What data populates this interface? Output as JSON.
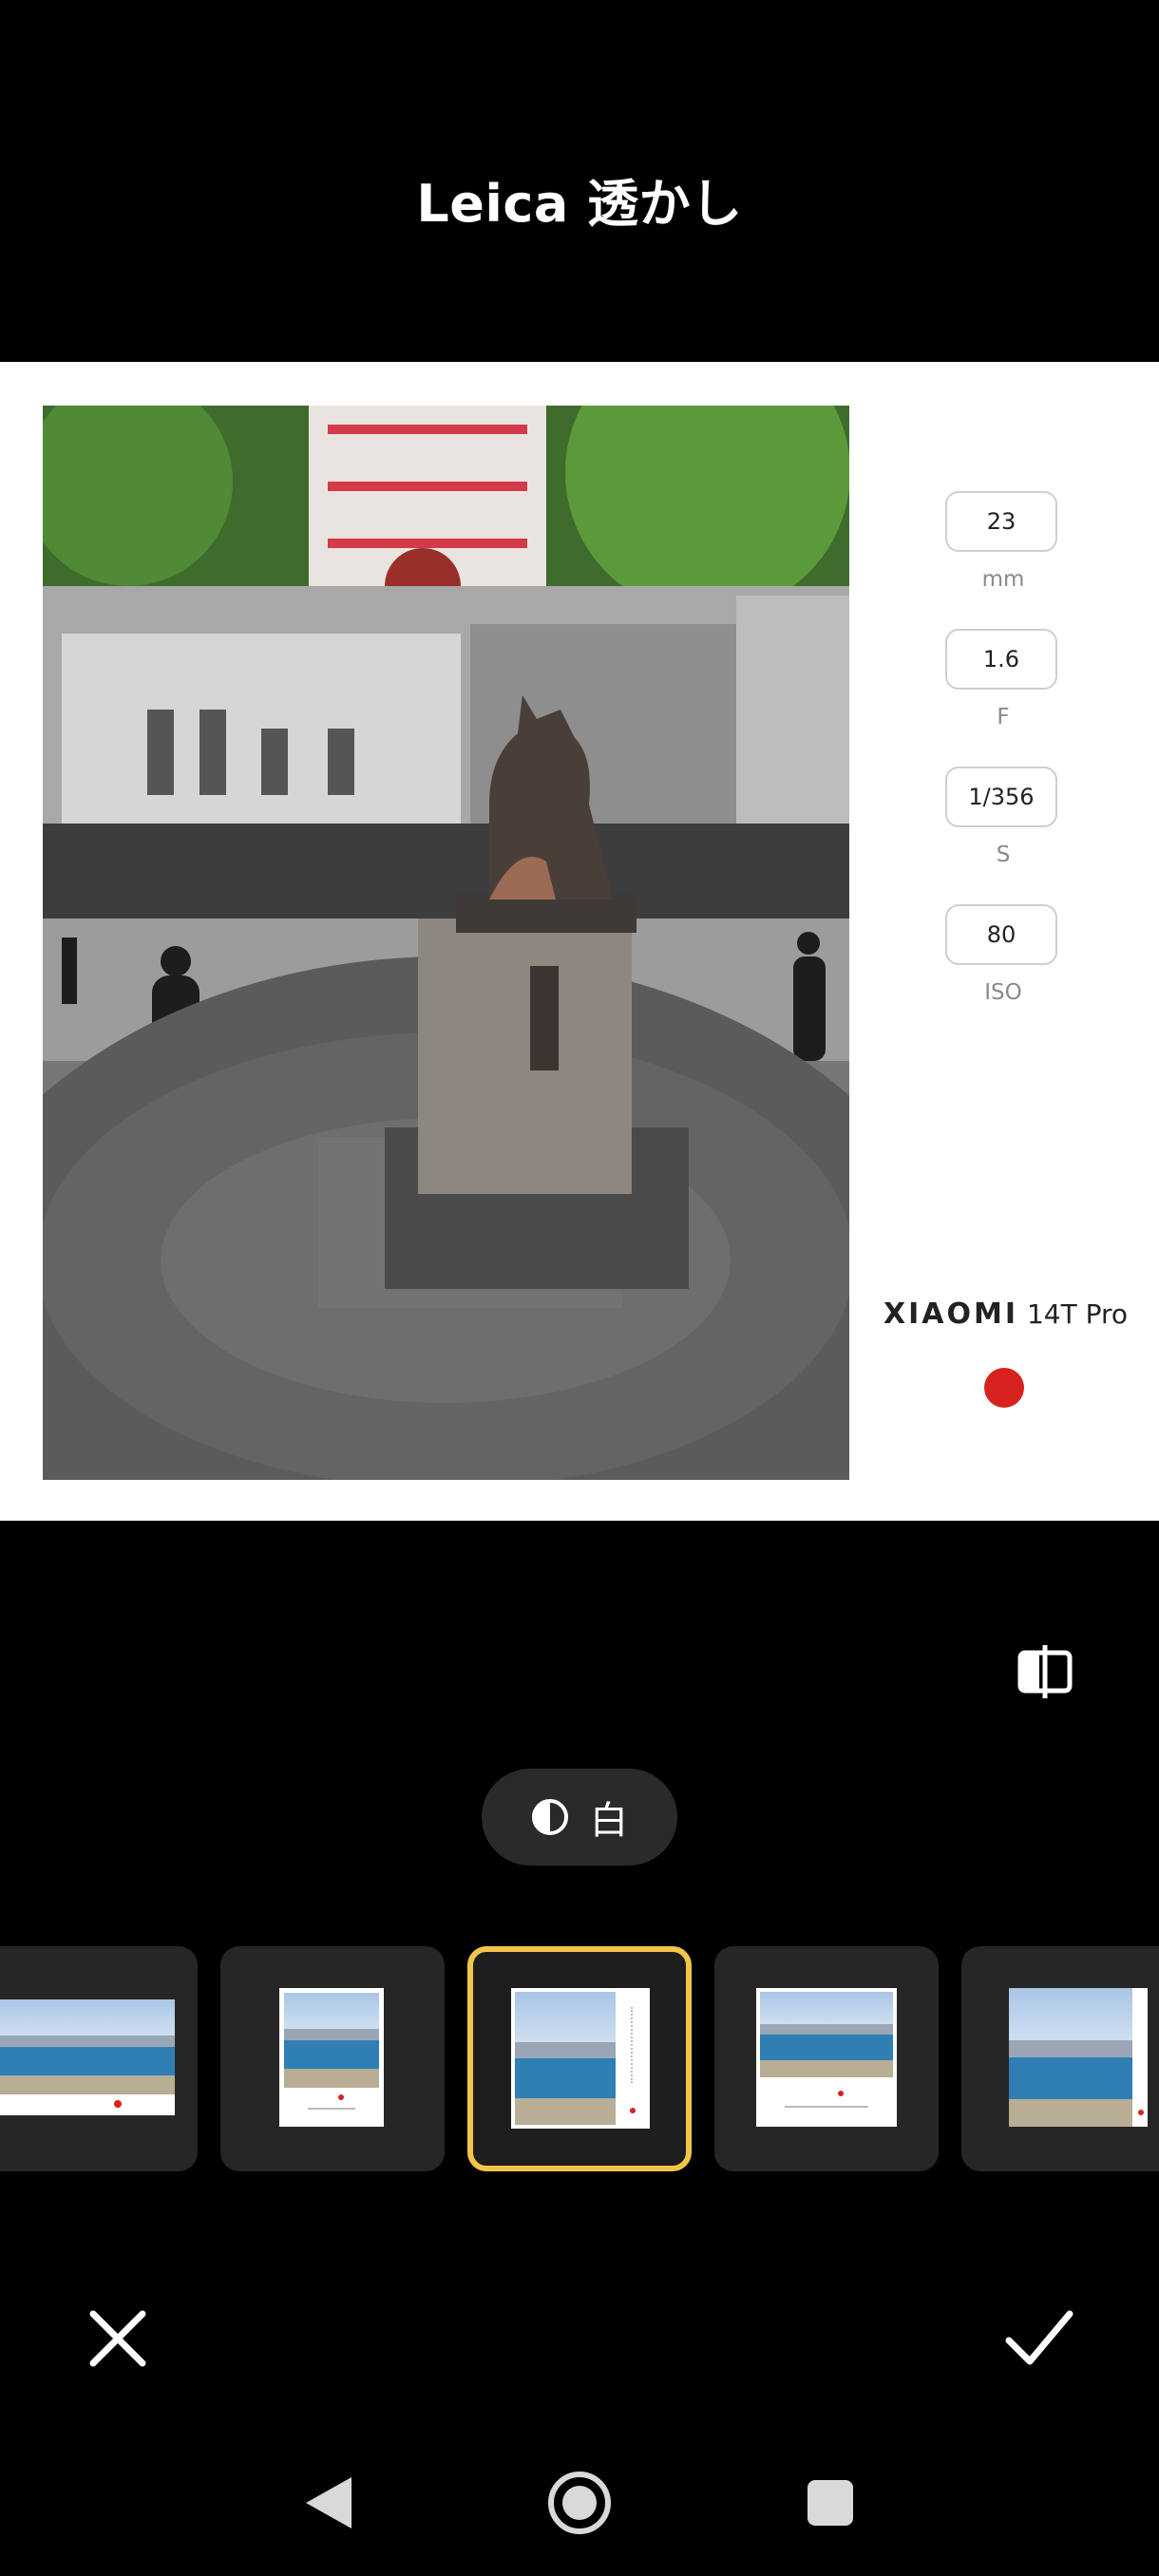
{
  "header": {
    "title": "Leica 透かし"
  },
  "exif": [
    {
      "value": "23",
      "unit": "mm"
    },
    {
      "value": "1.6",
      "unit": "F"
    },
    {
      "value": "1/356",
      "unit": "S"
    },
    {
      "value": "80",
      "unit": "ISO"
    }
  ],
  "brand": {
    "logo": "XIAOMI",
    "model": "14T Pro",
    "leica_badge": "Leica"
  },
  "toggle": {
    "label": "白",
    "icon": "contrast-icon"
  },
  "templates": {
    "selected_index": 2,
    "count": 5
  },
  "icons": {
    "compare": "compare-icon",
    "cancel": "close-icon",
    "confirm": "check-icon",
    "nav_back": "back-triangle-icon",
    "nav_home": "home-circle-icon",
    "nav_recents": "recents-square-icon"
  },
  "colors": {
    "selected_border": "#f2c54a",
    "leica_red": "#d8221e",
    "background": "#000000"
  }
}
